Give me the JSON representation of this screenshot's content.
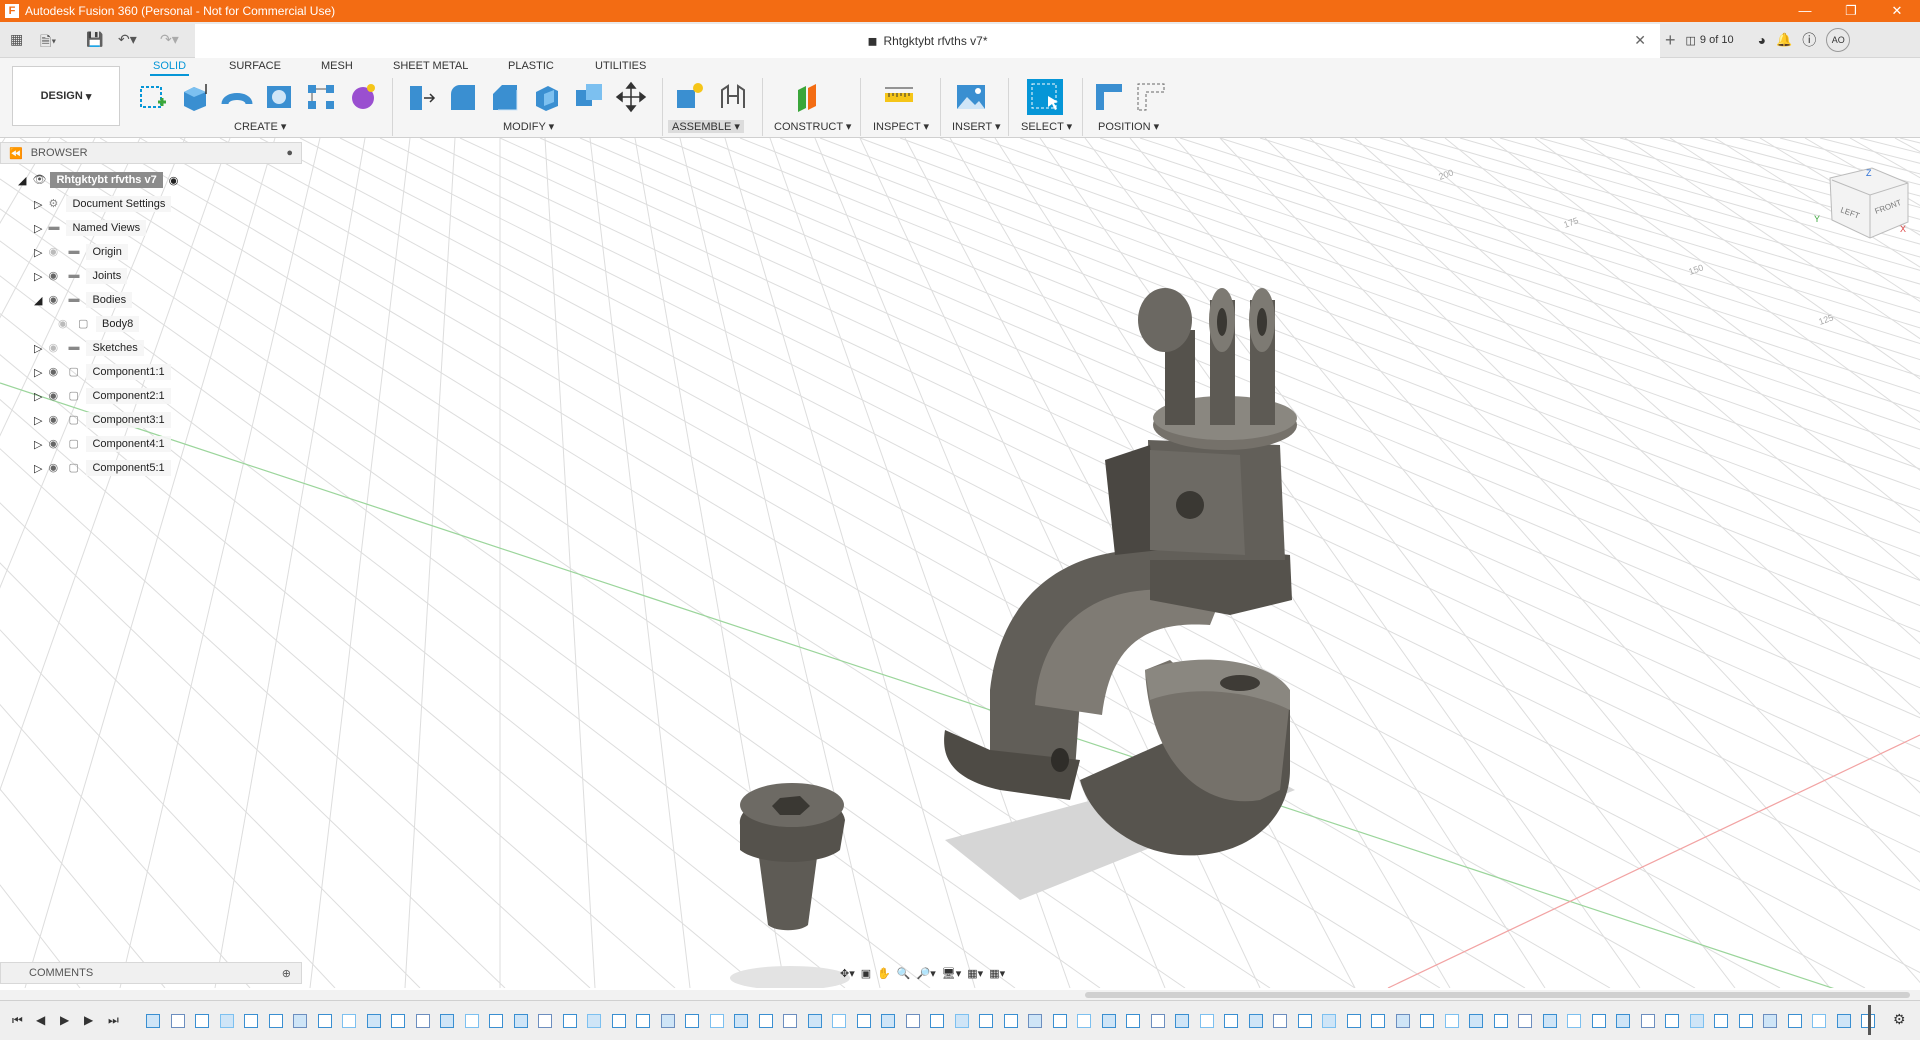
{
  "window": {
    "title": "Autodesk Fusion 360 (Personal - Not for Commercial Use)",
    "logo": "F"
  },
  "document": {
    "tab_title": "Rhtgktybt rfvths v7*",
    "version_nav": "9 of 10",
    "user_initials": "AO"
  },
  "workspace": {
    "design_label": "DESIGN"
  },
  "ribbon": {
    "tabs": [
      "SOLID",
      "SURFACE",
      "MESH",
      "SHEET METAL",
      "PLASTIC",
      "UTILITIES"
    ],
    "active_tab": "SOLID",
    "groups": {
      "create": "CREATE",
      "modify": "MODIFY",
      "assemble": "ASSEMBLE",
      "construct": "CONSTRUCT",
      "inspect": "INSPECT",
      "insert": "INSERT",
      "select": "SELECT",
      "position": "POSITION"
    }
  },
  "browser": {
    "header": "BROWSER",
    "root": "Rhtgktybt rfvths v7",
    "items": [
      {
        "label": "Document Settings",
        "icon": "gear-icon"
      },
      {
        "label": "Named Views",
        "icon": "folder-icon"
      },
      {
        "label": "Origin",
        "icon": "folder-icon",
        "hidden": true
      },
      {
        "label": "Joints",
        "icon": "folder-icon"
      },
      {
        "label": "Bodies",
        "icon": "folder-icon",
        "expanded": true
      },
      {
        "label": "Body8",
        "icon": "body-icon",
        "hidden": true
      },
      {
        "label": "Sketches",
        "icon": "folder-icon",
        "hidden": true
      },
      {
        "label": "Component1:1",
        "icon": "component-icon"
      },
      {
        "label": "Component2:1",
        "icon": "component-icon"
      },
      {
        "label": "Component3:1",
        "icon": "component-icon"
      },
      {
        "label": "Component4:1",
        "icon": "component-icon"
      },
      {
        "label": "Component5:1",
        "icon": "component-icon"
      }
    ]
  },
  "comments": {
    "header": "COMMENTS"
  },
  "viewcube": {
    "top": "Z",
    "left": "LEFT",
    "front": "FRONT",
    "x_axis": "X",
    "y_axis": "Y"
  },
  "grid_labels": [
    "200",
    "175",
    "150",
    "125"
  ],
  "colors": {
    "brand_orange": "#f36c13",
    "accent_blue": "#0696d7",
    "model_gray": "#6b6862"
  }
}
